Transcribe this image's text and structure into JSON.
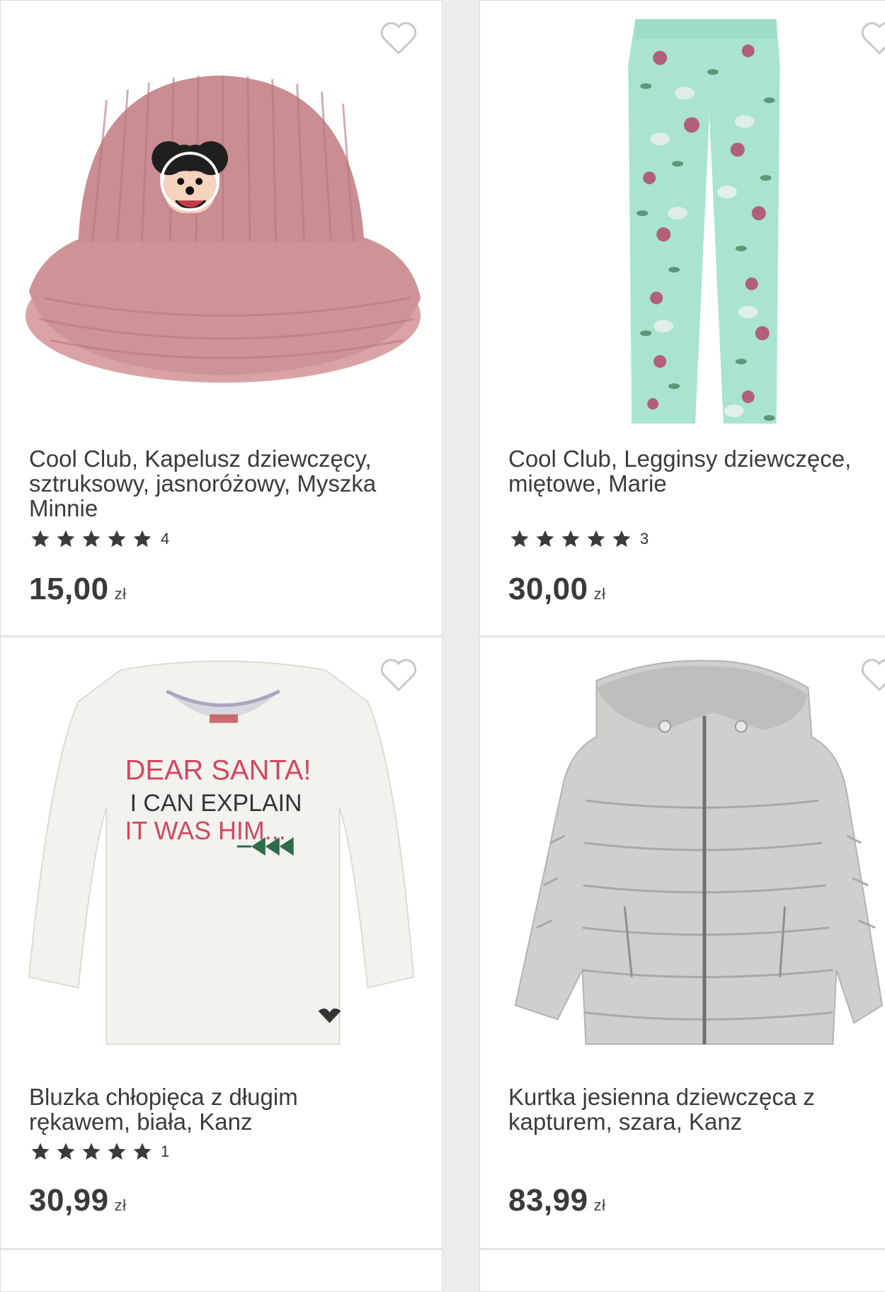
{
  "products": [
    {
      "title": "Cool Club, Kapelusz dziewczęcy, sztruksowy, jasnoróżowy, Myszka Minnie",
      "rating_count": "4",
      "price": "15,00",
      "currency": "zł",
      "stars": 5,
      "image": "pink-corduroy-bucket-hat"
    },
    {
      "title": "Cool Club, Legginsy dziewczęce, miętowe, Marie",
      "rating_count": "3",
      "price": "30,00",
      "currency": "zł",
      "stars": 5,
      "image": "mint-floral-leggings"
    },
    {
      "title": "Bluzka chłopięca z długim rękawem, biała, Kanz",
      "rating_count": "1",
      "price": "30,99",
      "currency": "zł",
      "stars": 5,
      "image": "white-longsleeve-shirt",
      "print_text": [
        "DEAR SANTA!",
        "I CAN EXPLAIN",
        "IT WAS HIM..."
      ]
    },
    {
      "title": "Kurtka jesienna dziewczęca z kapturem, szara, Kanz",
      "price": "83,99",
      "currency": "zł",
      "image": "grey-puffer-jacket"
    }
  ],
  "icons": {
    "favorite": "heart-outline-icon",
    "rating": "star-icon"
  },
  "colors": {
    "background": "#ececec",
    "card": "#ffffff",
    "text": "#333333",
    "star": "#3b3b3b",
    "heart_outline": "#c8c8c8"
  }
}
